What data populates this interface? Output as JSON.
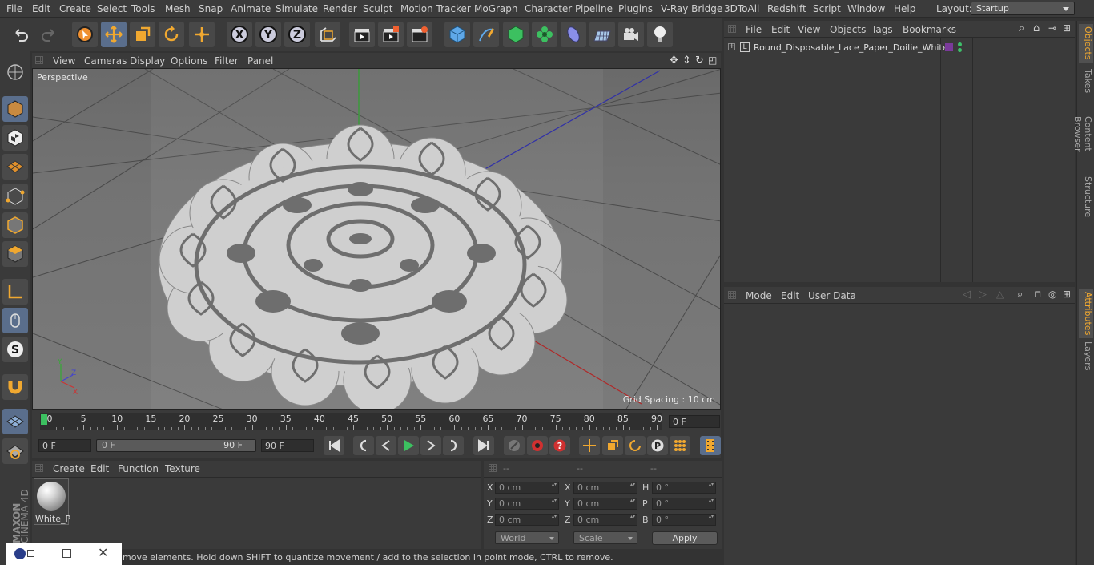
{
  "menu": {
    "items": [
      "File",
      "Edit",
      "Create",
      "Select",
      "Tools",
      "Mesh",
      "Snap",
      "Animate",
      "Simulate",
      "Render",
      "Sculpt",
      "Motion Tracker",
      "MoGraph",
      "Character",
      "Pipeline",
      "Plugins",
      "V-Ray Bridge",
      "3DToAll",
      "Redshift",
      "Script",
      "Window",
      "Help"
    ],
    "layout_label": "Layout:",
    "layout_value": "Startup"
  },
  "viewport": {
    "menu": [
      "View",
      "Cameras",
      "Display",
      "Options",
      "Filter",
      "Panel"
    ],
    "label": "Perspective",
    "grid_spacing": "Grid Spacing : 10 cm"
  },
  "timeline": {
    "ticks": [
      "0",
      "5",
      "10",
      "15",
      "20",
      "25",
      "30",
      "35",
      "40",
      "45",
      "50",
      "55",
      "60",
      "65",
      "70",
      "75",
      "80",
      "85",
      "90"
    ],
    "current_frame": "0 F",
    "start_field": "0 F",
    "range_start": "0 F",
    "range_end": "90 F",
    "end_field": "90 F"
  },
  "material_manager": {
    "menu": [
      "Create",
      "Edit",
      "Function",
      "Texture"
    ],
    "material_name": "White_P"
  },
  "coordinates": {
    "headers": [
      "--",
      "--",
      "--"
    ],
    "rows": [
      {
        "a": "X",
        "av": "0 cm",
        "b": "X",
        "bv": "0 cm",
        "c": "H",
        "cv": "0 °"
      },
      {
        "a": "Y",
        "av": "0 cm",
        "b": "Y",
        "bv": "0 cm",
        "c": "P",
        "cv": "0 °"
      },
      {
        "a": "Z",
        "av": "0 cm",
        "b": "Z",
        "bv": "0 cm",
        "c": "B",
        "cv": "0 °"
      }
    ],
    "mode_world": "World",
    "mode_scale": "Scale",
    "apply": "Apply"
  },
  "status": "move elements. Hold down SHIFT to quantize movement / add to the selection in point mode, CTRL to remove.",
  "objects": {
    "menu": [
      "File",
      "Edit",
      "View",
      "Objects",
      "Tags",
      "Bookmarks"
    ],
    "items": [
      "Round_Disposable_Lace_Paper_Doilie_White"
    ]
  },
  "attributes": {
    "menu": [
      "Mode",
      "Edit",
      "User Data"
    ]
  },
  "right_tabs": [
    "Objects",
    "Takes",
    "Content Browser",
    "Structure",
    "Attributes",
    "Layers"
  ],
  "brand": {
    "line1": "MAXON",
    "line2": "CINEMA 4D"
  },
  "colors": {
    "accent": "#5a6e8c",
    "orange": "#f0a830",
    "tag_purple": "#7a3a9a",
    "tag_green": "#3ec06a"
  }
}
